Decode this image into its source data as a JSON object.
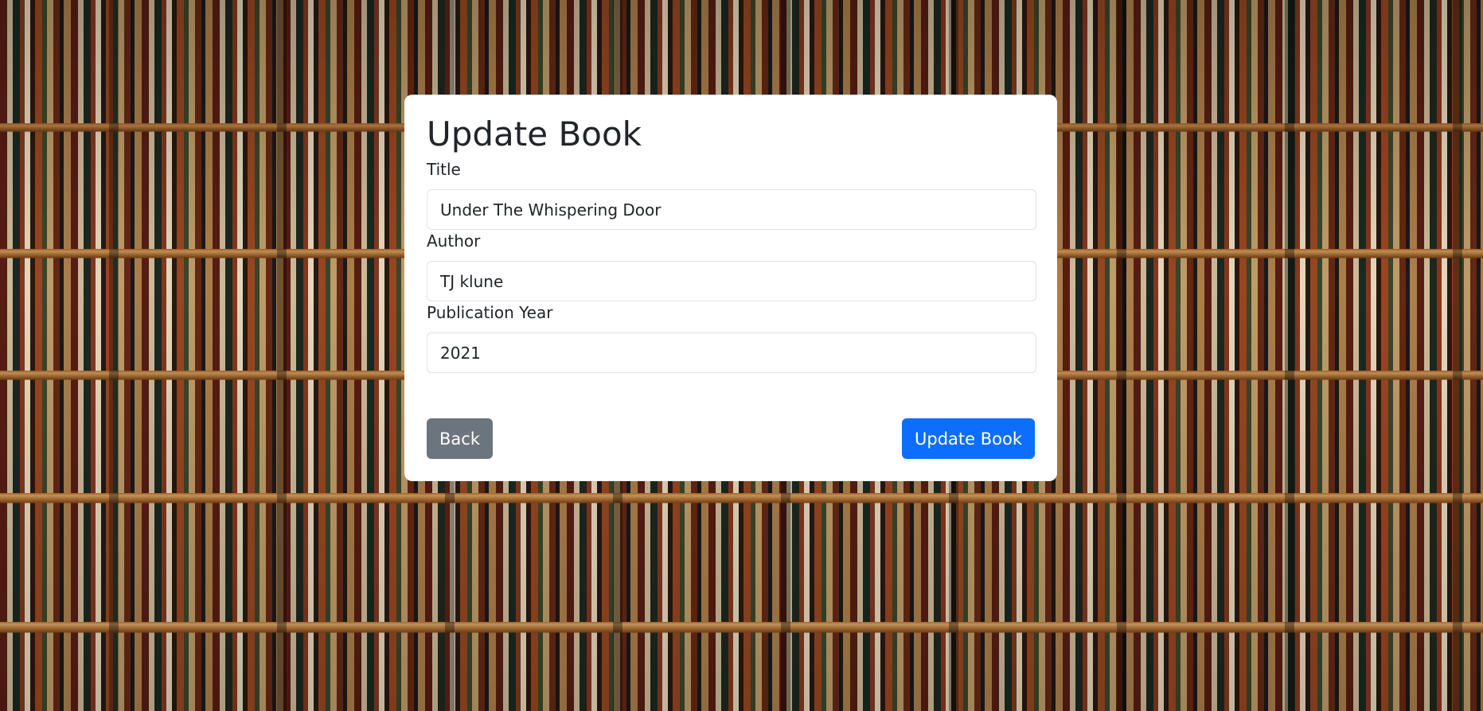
{
  "form": {
    "heading": "Update Book",
    "fields": [
      {
        "label": "Title",
        "value": "Under The Whispering Door"
      },
      {
        "label": "Author",
        "value": "TJ klune"
      },
      {
        "label": "Publication Year",
        "value": "2021"
      }
    ],
    "back_label": "Back",
    "submit_label": "Update Book"
  },
  "colors": {
    "primary": "#0d6efd",
    "secondary": "#6c757d",
    "text": "#212529"
  }
}
